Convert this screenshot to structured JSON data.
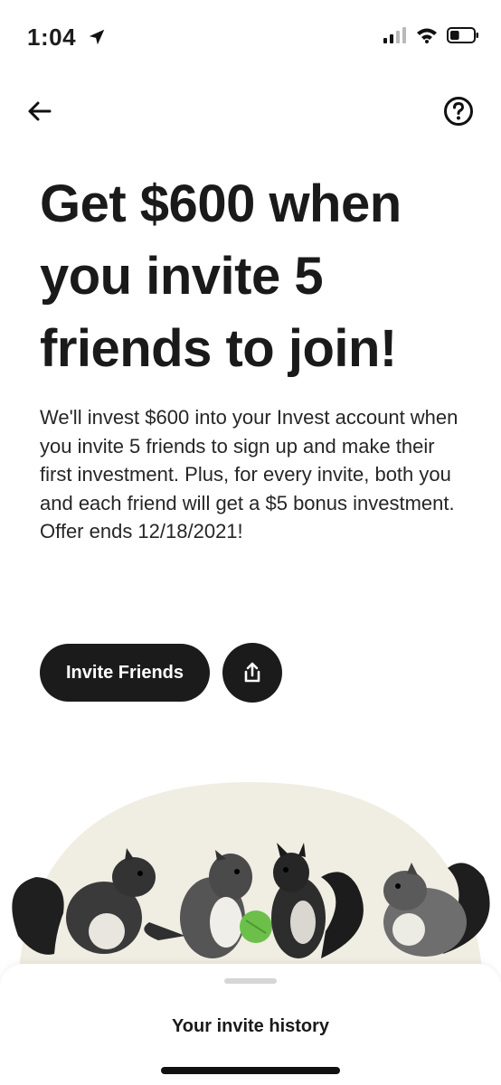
{
  "status_bar": {
    "time": "1:04",
    "location_icon": "location-arrow-icon",
    "signal_icon": "cellular-signal-icon",
    "wifi_icon": "wifi-icon",
    "battery_icon": "battery-icon",
    "battery_level": 0.4
  },
  "header": {
    "back_icon": "arrow-left-icon",
    "help_icon": "question-circle-icon"
  },
  "hero": {
    "headline": "Get $600 when you invite 5 friends to join!",
    "body": "We'll invest $600 into your Invest account when you invite 5 friends to sign up and make their first investment. Plus, for every invite, both you and each friend will get a $5 bonus investment. Offer ends 12/18/2021!"
  },
  "actions": {
    "invite_label": "Invite Friends",
    "share_icon": "share-icon"
  },
  "illustration": {
    "subject": "squirrels-illustration",
    "accent_color": "#6cc04a",
    "backdrop_color": "#f0ede3"
  },
  "sheet": {
    "title": "Your invite history"
  },
  "colors": {
    "primary_dark": "#1b1b1b",
    "background": "#ffffff",
    "text": "#1a1a1a"
  }
}
